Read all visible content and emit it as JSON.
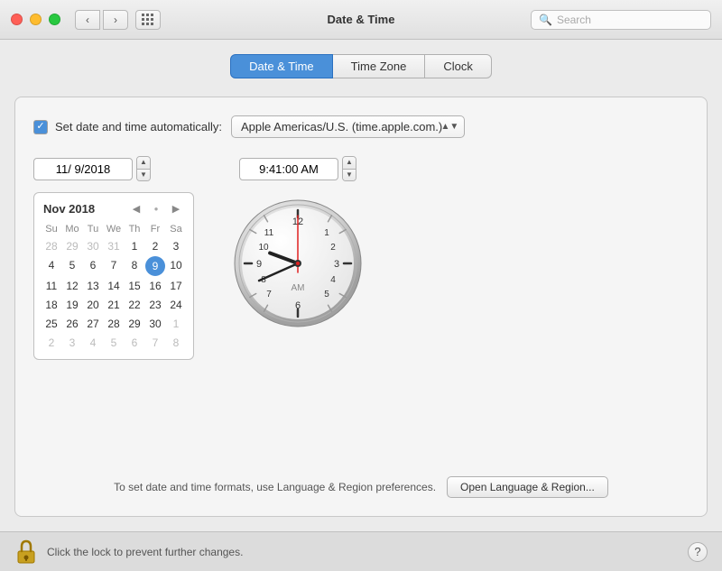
{
  "titlebar": {
    "title": "Date & Time",
    "search_placeholder": "Search"
  },
  "tabs": [
    {
      "id": "date-time",
      "label": "Date & Time",
      "active": true
    },
    {
      "id": "time-zone",
      "label": "Time Zone",
      "active": false
    },
    {
      "id": "clock",
      "label": "Clock",
      "active": false
    }
  ],
  "auto_set": {
    "checkbox_label": "Set date and time automatically:",
    "server": "Apple Americas/U.S. (time.apple.com.)"
  },
  "date": {
    "value": "11/  9/2018"
  },
  "time": {
    "value": "9:41:00 AM"
  },
  "calendar": {
    "month_year": "Nov 2018",
    "day_headers": [
      "Su",
      "Mo",
      "Tu",
      "We",
      "Th",
      "Fr",
      "Sa"
    ],
    "weeks": [
      [
        "28",
        "29",
        "30",
        "31",
        "1",
        "2",
        "3"
      ],
      [
        "4",
        "5",
        "6",
        "7",
        "8",
        "9",
        "10"
      ],
      [
        "11",
        "12",
        "13",
        "14",
        "15",
        "16",
        "17"
      ],
      [
        "18",
        "19",
        "20",
        "21",
        "22",
        "23",
        "24"
      ],
      [
        "25",
        "26",
        "27",
        "28",
        "29",
        "30",
        "1"
      ],
      [
        "2",
        "3",
        "4",
        "5",
        "6",
        "7",
        "8"
      ]
    ],
    "other_month_days": [
      "28",
      "29",
      "30",
      "31",
      "1",
      "2",
      "3",
      "1",
      "2",
      "3",
      "4",
      "5",
      "6",
      "7",
      "8"
    ],
    "selected_day": "9"
  },
  "clock": {
    "am_label": "AM",
    "hour": 9,
    "minute": 41,
    "second": 0
  },
  "bottom_note": {
    "text": "To set date and time formats, use Language & Region preferences.",
    "button_label": "Open Language & Region..."
  },
  "footer": {
    "lock_text": "Click the lock to prevent further changes.",
    "help_label": "?"
  }
}
